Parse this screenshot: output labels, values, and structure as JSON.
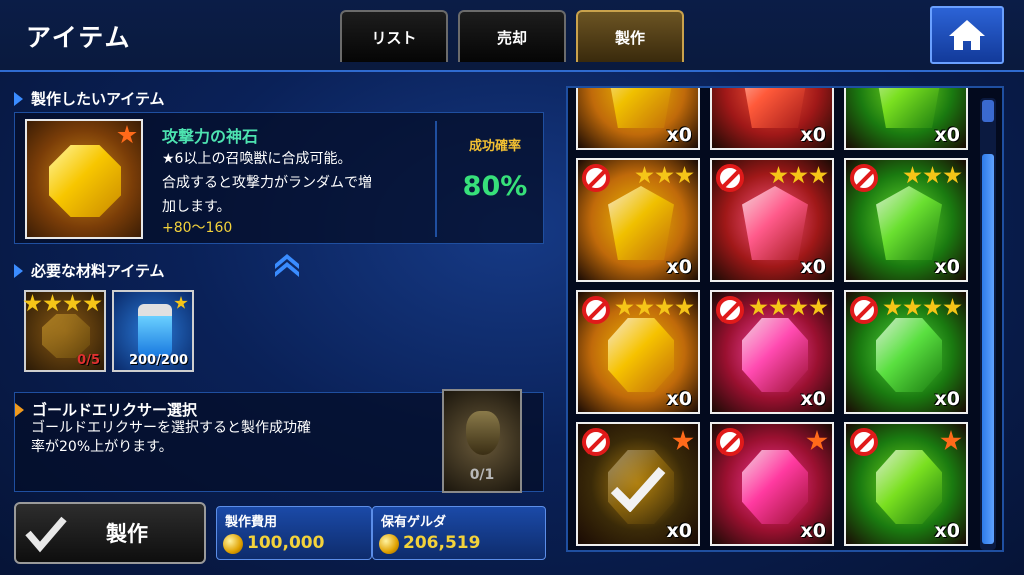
{
  "header": {
    "title": "アイテム",
    "tabs": [
      "リスト",
      "売却",
      "製作"
    ],
    "active_tab": 2
  },
  "craft": {
    "section_label": "製作したいアイテム",
    "item_name": "攻撃力の神石",
    "desc_line1": "★6以上の召喚獣に合成可能。",
    "desc_line2": "合成すると攻撃力がランダムで増",
    "desc_line3": "加します。",
    "bonus": "+80～160",
    "rate_label": "成功確率",
    "rate_value": "80%"
  },
  "materials": {
    "section_label": "必要な材料アイテム",
    "items": [
      {
        "count": "0/5",
        "stars": 4
      },
      {
        "count": "200/200",
        "stars": 1
      }
    ]
  },
  "elixir": {
    "section_label": "ゴールドエリクサー選択",
    "desc_line1": "ゴールドエリクサーを選択すると製作成功確",
    "desc_line2": "率が20%上がります。",
    "count": "0/1"
  },
  "actions": {
    "make_label": "製作"
  },
  "cost": {
    "label": "製作費用",
    "value": "100,000"
  },
  "owned": {
    "label": "保有ゲルダ",
    "value": "206,519"
  },
  "grid": {
    "cells": [
      {
        "color": "#f0c000",
        "bg": "#c06a0a",
        "count": "x0",
        "stars": 0,
        "blocked": false
      },
      {
        "color": "#ff5a3a",
        "bg": "#a01818",
        "count": "x0",
        "stars": 0,
        "blocked": false
      },
      {
        "color": "#7ae020",
        "bg": "#1a7a10",
        "count": "x0",
        "stars": 0,
        "blocked": false
      },
      {
        "color": "#f0c000",
        "bg": "#c06a0a",
        "count": "x0",
        "stars": 3,
        "blocked": true
      },
      {
        "color": "#ff5a8a",
        "bg": "#a01818",
        "count": "x0",
        "stars": 3,
        "blocked": true
      },
      {
        "color": "#6ae030",
        "bg": "#1a7a10",
        "count": "x0",
        "stars": 3,
        "blocked": true
      },
      {
        "color": "#f6c200",
        "bg": "#c06a0a",
        "count": "x0",
        "stars": 4,
        "blocked": true
      },
      {
        "color": "#ff4ab0",
        "bg": "#9a1030",
        "count": "x0",
        "stars": 4,
        "blocked": true
      },
      {
        "color": "#5ae040",
        "bg": "#1a7a10",
        "count": "x0",
        "stars": 4,
        "blocked": true
      },
      {
        "color": "#b08010",
        "bg": "#3a2a08",
        "count": "x0",
        "stars": 1,
        "blocked": true,
        "checked": true
      },
      {
        "color": "#ff3aa0",
        "bg": "#9a1030",
        "count": "x0",
        "stars": 1,
        "blocked": true
      },
      {
        "color": "#7ae020",
        "bg": "#1a7a10",
        "count": "x0",
        "stars": 1,
        "blocked": true
      }
    ]
  }
}
